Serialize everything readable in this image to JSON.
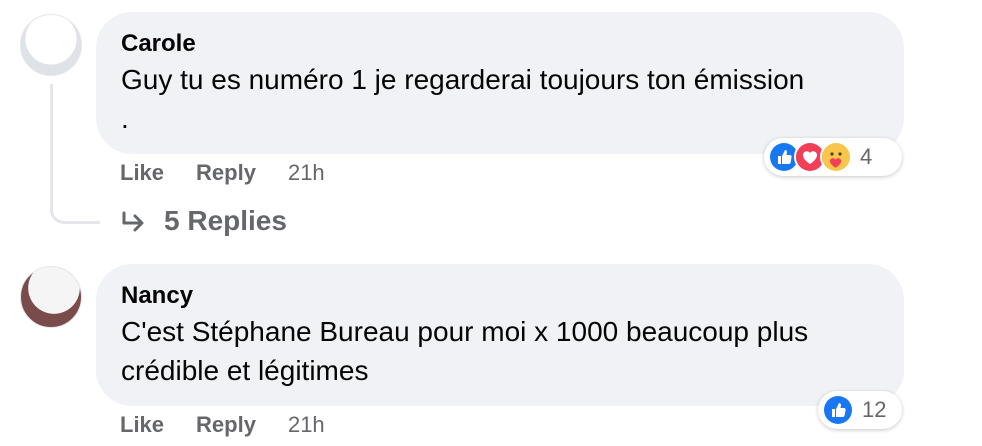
{
  "comments": [
    {
      "author": "Carole",
      "text_line1": "Guy tu es numéro 1 je regarderai toujours ton émission",
      "text_line2": ".",
      "like_label": "Like",
      "reply_label": "Reply",
      "time": "21h",
      "reactions": {
        "icons": [
          "like-icon",
          "love-icon",
          "care-icon"
        ],
        "count": "4"
      },
      "replies_label": "5 Replies"
    },
    {
      "author": "Nancy",
      "text_line1": "C'est Stéphane Bureau pour moi x 1000 beaucoup plus",
      "text_line2": "crédible et légitimes",
      "like_label": "Like",
      "reply_label": "Reply",
      "time": "21h",
      "reactions": {
        "icons": [
          "like-icon"
        ],
        "count": "12"
      }
    }
  ],
  "colors": {
    "bubble": "#f0f2f5",
    "secondary_text": "#65676b",
    "like_blue": "#1877f2",
    "love_red": "#f33e58"
  }
}
